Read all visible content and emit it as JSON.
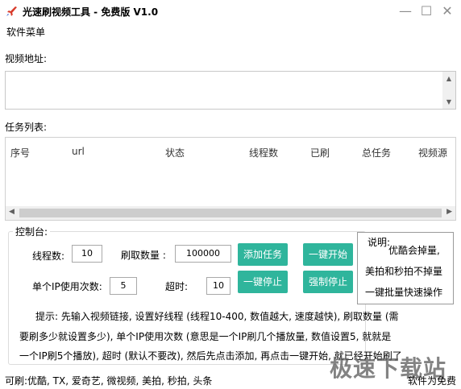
{
  "window": {
    "title": "光速刷视频工具 - 免费版 V1.0",
    "menu": "软件菜单",
    "controls": {
      "minimize": "—",
      "maximize": "☐",
      "close": "✕"
    }
  },
  "url": {
    "label": "视频地址:",
    "value": ""
  },
  "tasks": {
    "label": "任务列表:",
    "columns": [
      "序号",
      "url",
      "状态",
      "线程数",
      "已刷",
      "总任务",
      "视频源"
    ],
    "rows": []
  },
  "control": {
    "title": "控制台:",
    "threads_label": "线程数:",
    "threads_value": "10",
    "count_label": "刷取数量 :",
    "count_value": "100000",
    "ip_label": "单个IP使用次数:",
    "ip_value": "5",
    "timeout_label": "超时:",
    "timeout_value": "10",
    "buttons": {
      "add": "添加任务",
      "start_all": "一键开始",
      "stop_all": "一键停止",
      "force_stop": "强制停止"
    }
  },
  "info": {
    "title": "说明:",
    "lines": [
      "优酷会掉量,",
      "美拍和秒拍不掉量",
      "一键批量快速操作"
    ]
  },
  "tips": {
    "line1": "提示: 先输入视频链接, 设置好线程 (线程10-400, 数值越大, 速度越快), 刷取数量 (需",
    "line2": "要刷多少就设置多少), 单个IP使用次数 (意思是一个IP刷几个播放量, 数值设置5, 就就是",
    "line3": "一个IP刷5个播放), 超时 (默认不要改), 然后先点击添加, 再点击一键开始, 就已经开始刷了"
  },
  "status": {
    "left": "可刷:优酷, TX, 爱奇艺, 微视频, 美拍, 秒拍, 头条",
    "right": "软件为免费"
  },
  "watermark": "极速下载站",
  "colors": {
    "accent": "#2fb59c"
  }
}
